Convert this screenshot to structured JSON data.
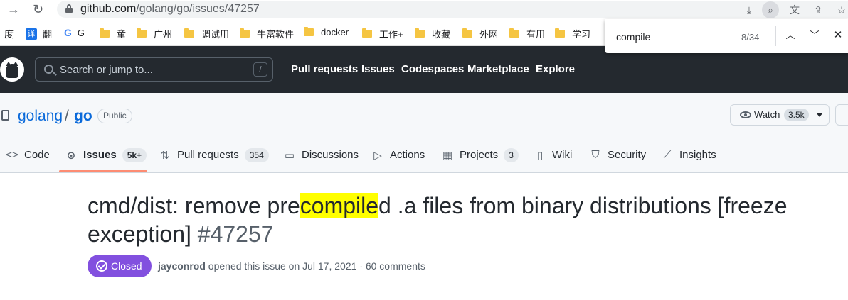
{
  "browser": {
    "url_host": "github.com",
    "url_path": "/golang/go/issues/47257",
    "bookmarks": [
      {
        "label": "度",
        "kind": "text"
      },
      {
        "label": "翻",
        "kind": "translate"
      },
      {
        "label": "G",
        "kind": "google"
      },
      {
        "label": "童",
        "kind": "folder"
      },
      {
        "label": "广州",
        "kind": "folder"
      },
      {
        "label": "调试用",
        "kind": "folder"
      },
      {
        "label": "牛富软件",
        "kind": "folder"
      },
      {
        "label": "docker",
        "kind": "folder"
      },
      {
        "label": "工作+",
        "kind": "folder"
      },
      {
        "label": "收藏",
        "kind": "folder"
      },
      {
        "label": "外网",
        "kind": "folder"
      },
      {
        "label": "有用",
        "kind": "folder"
      },
      {
        "label": "学习",
        "kind": "folder"
      }
    ]
  },
  "find_bar": {
    "query": "compile",
    "count": "8/34"
  },
  "gh_header": {
    "search_placeholder": "Search or jump to...",
    "search_shortcut": "/",
    "nav": [
      "Pull requests",
      "Issues",
      "Codespaces",
      "Marketplace",
      "Explore"
    ]
  },
  "repo": {
    "owner": "golang",
    "separator": "/",
    "name": "go",
    "visibility": "Public",
    "watch_label": "Watch",
    "watch_count": "3.5k"
  },
  "tabs": [
    {
      "label": "Code",
      "icon": "code-icon",
      "count": ""
    },
    {
      "label": "Issues",
      "icon": "issue-icon",
      "count": "5k+"
    },
    {
      "label": "Pull requests",
      "icon": "pull-request-icon",
      "count": "354"
    },
    {
      "label": "Discussions",
      "icon": "discussion-icon",
      "count": ""
    },
    {
      "label": "Actions",
      "icon": "play-icon",
      "count": ""
    },
    {
      "label": "Projects",
      "icon": "table-icon",
      "count": "3"
    },
    {
      "label": "Wiki",
      "icon": "book-icon",
      "count": ""
    },
    {
      "label": "Security",
      "icon": "shield-icon",
      "count": ""
    },
    {
      "label": "Insights",
      "icon": "graph-icon",
      "count": ""
    }
  ],
  "issue": {
    "title_before": "cmd/dist: remove pre",
    "title_highlight": "compile",
    "title_after": "d .a files from binary distributions [freeze exception]",
    "number": "#47257",
    "state": "Closed",
    "author": "jayconrod",
    "meta_text": "opened this issue on Jul 17, 2021 · 60 comments"
  },
  "colors": {
    "header_bg": "#24292f",
    "link": "#0969da",
    "closed": "#8250df",
    "tab_underline": "#fd8c73",
    "find_highlight": "#ffff00"
  }
}
